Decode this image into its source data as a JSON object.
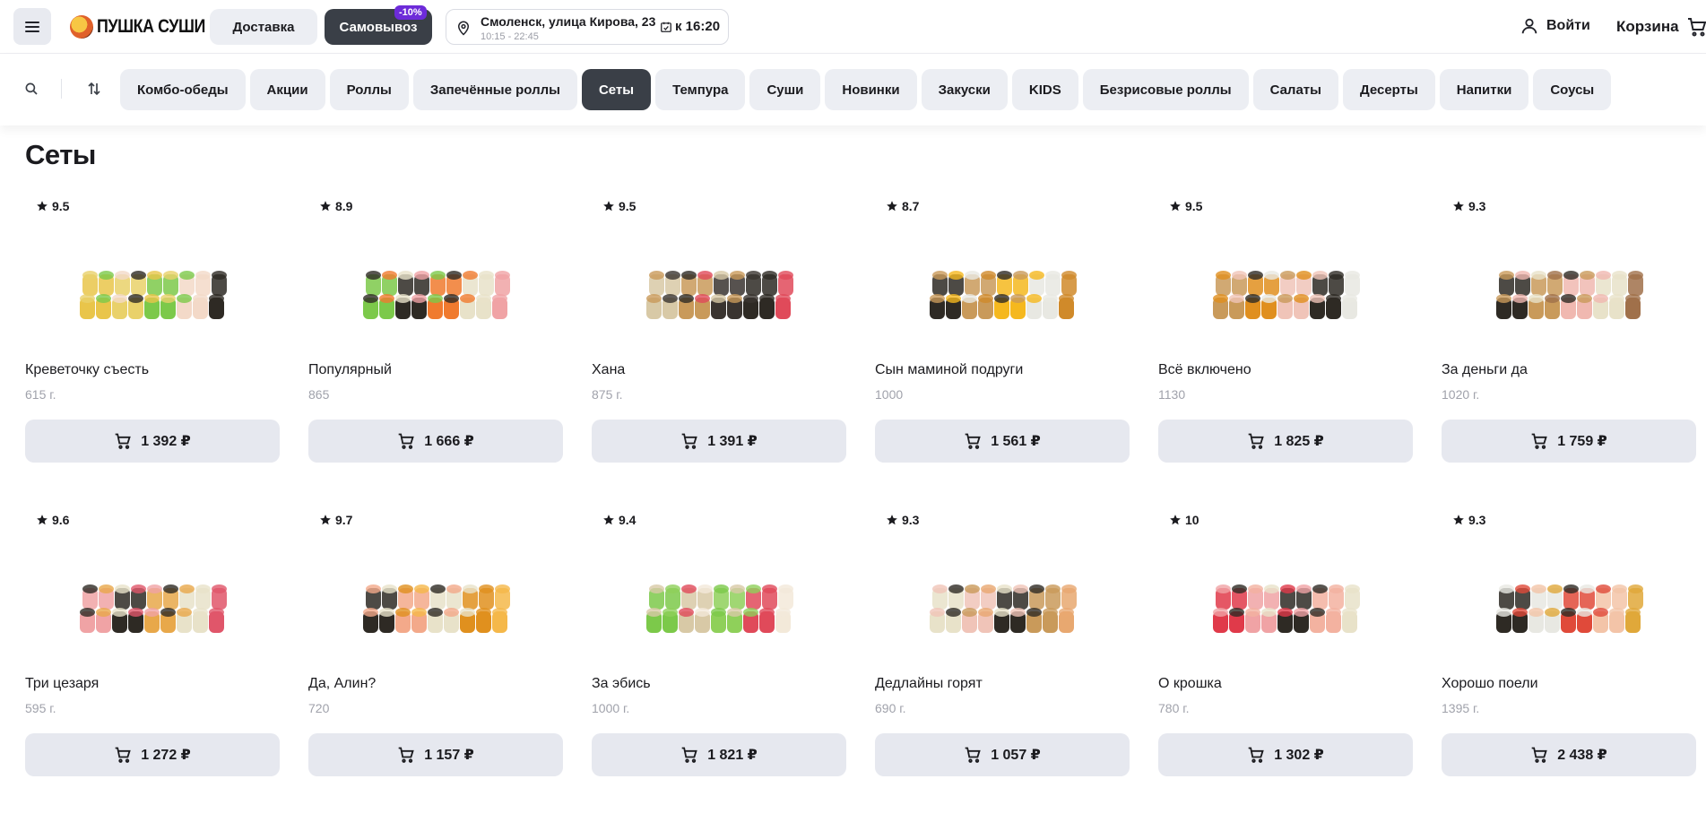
{
  "header": {
    "brand": "ПУШКА СУШИ",
    "delivery_label": "Доставка",
    "pickup_label": "Самовывоз",
    "discount": "-10%",
    "address": "Смоленск, улица Кирова, 23",
    "hours": "10:15 - 22:45",
    "ready_time": "к 16:20",
    "login_label": "Войти",
    "cart_label": "Корзина"
  },
  "categories": [
    {
      "label": "Комбо-обеды",
      "active": false
    },
    {
      "label": "Акции",
      "active": false
    },
    {
      "label": "Роллы",
      "active": false
    },
    {
      "label": "Запечённые роллы",
      "active": false
    },
    {
      "label": "Сеты",
      "active": true
    },
    {
      "label": "Темпура",
      "active": false
    },
    {
      "label": "Суши",
      "active": false
    },
    {
      "label": "Новинки",
      "active": false
    },
    {
      "label": "Закуски",
      "active": false
    },
    {
      "label": "KIDS",
      "active": false
    },
    {
      "label": "Безрисовые роллы",
      "active": false
    },
    {
      "label": "Салаты",
      "active": false
    },
    {
      "label": "Десерты",
      "active": false
    },
    {
      "label": "Напитки",
      "active": false
    },
    {
      "label": "Соусы",
      "active": false
    }
  ],
  "page_title": "Сеты",
  "products": [
    {
      "name": "Креветочку съесть",
      "weight": "615 г.",
      "rating": "9.5",
      "price": "1 392 ₽",
      "colors": [
        "#e9c54a",
        "#e9d16a",
        "#7cc94a",
        "#f3d9c8",
        "#2e2a24"
      ]
    },
    {
      "name": "Популярный",
      "weight": "865",
      "rating": "8.9",
      "price": "1 666 ₽",
      "colors": [
        "#f0a3a5",
        "#7cc94a",
        "#2e2a24",
        "#f07a2e",
        "#e8e2c9"
      ]
    },
    {
      "name": "Хана",
      "weight": "875 г.",
      "rating": "9.5",
      "price": "1 391 ₽",
      "colors": [
        "#2e2a24",
        "#e04a5a",
        "#d8c9a6",
        "#c99a5a",
        "#3a3430"
      ]
    },
    {
      "name": "Сын маминой подруги",
      "weight": "1000",
      "rating": "8.7",
      "price": "1 561 ₽",
      "colors": [
        "#f5b81e",
        "#e8e8e2",
        "#d08a2a",
        "#2e2a24",
        "#c99a5a"
      ]
    },
    {
      "name": "Всё включено",
      "weight": "1130",
      "rating": "9.5",
      "price": "1 825 ₽",
      "colors": [
        "#e08f1e",
        "#f0c4b8",
        "#2e2a24",
        "#e8e8e2",
        "#c99a5a"
      ]
    },
    {
      "name": "За деньги да",
      "weight": "1020 г.",
      "rating": "9.3",
      "price": "1 759 ₽",
      "colors": [
        "#2e2a24",
        "#c99a5a",
        "#f0b8b0",
        "#e8e2c9",
        "#a0704a"
      ]
    },
    {
      "name": "Три цезаря",
      "weight": "595 г.",
      "rating": "9.6",
      "price": "1 272 ₽",
      "colors": [
        "#e0566a",
        "#f0a3a5",
        "#2e2a24",
        "#e8a84a",
        "#e8e2c9"
      ]
    },
    {
      "name": "Да, Алин?",
      "weight": "720",
      "rating": "9.7",
      "price": "1 157 ₽",
      "colors": [
        "#e0901e",
        "#f5b84a",
        "#2e2a24",
        "#f3a98a",
        "#e8e2c9"
      ]
    },
    {
      "name": "За эбись",
      "weight": "1000 г.",
      "rating": "9.4",
      "price": "1 821 ₽",
      "colors": [
        "#8fd05a",
        "#e04a5a",
        "#f3e9d9",
        "#7cc94a",
        "#d8c9a6"
      ]
    },
    {
      "name": "Дедлайны горят",
      "weight": "690 г.",
      "rating": "9.3",
      "price": "1 057 ₽",
      "colors": [
        "#f0c4b8",
        "#2e2a24",
        "#c99a5a",
        "#e8a870",
        "#e8e2c9"
      ]
    },
    {
      "name": "О крошка",
      "weight": "780 г.",
      "rating": "10",
      "price": "1 302 ₽",
      "colors": [
        "#e03a4a",
        "#f0a3a5",
        "#2e2a24",
        "#f3b2a0",
        "#e8e2c9"
      ]
    },
    {
      "name": "Хорошо поели",
      "weight": "1395 г.",
      "rating": "9.3",
      "price": "2 438 ₽",
      "colors": [
        "#e0a83a",
        "#2e2a24",
        "#e8e8e2",
        "#e04a3a",
        "#f3c4a8"
      ]
    }
  ]
}
